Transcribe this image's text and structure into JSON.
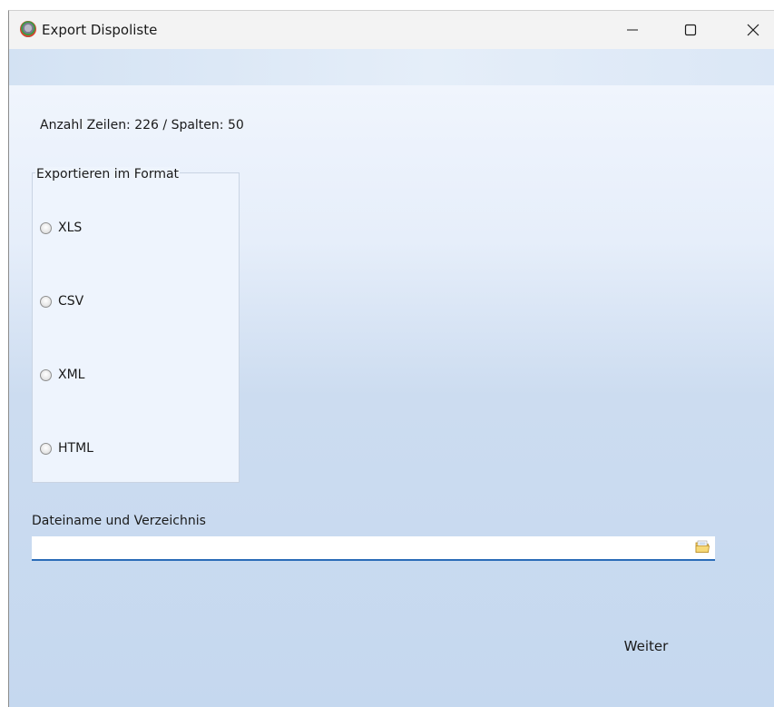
{
  "window": {
    "title": "Export Dispoliste",
    "controls": {
      "minimize": "minimize-icon",
      "maximize": "maximize-icon",
      "close": "close-icon"
    }
  },
  "summary": {
    "row_count_text": "Anzahl Zeilen: 226 / Spalten: 50"
  },
  "format_group": {
    "legend": "Exportieren im Format",
    "options": [
      {
        "label": "XLS",
        "checked": false
      },
      {
        "label": "CSV",
        "checked": false
      },
      {
        "label": "XML",
        "checked": false
      },
      {
        "label": "HTML",
        "checked": false
      }
    ]
  },
  "path": {
    "label": "Dateiname und Verzeichnis",
    "value": "",
    "browse_icon": "folder-icon"
  },
  "actions": {
    "next_label": "Weiter"
  },
  "colors": {
    "input_underline": "#2b6cb8",
    "background_top": "#f0f5fd",
    "background_bottom": "#c5d8ef"
  }
}
